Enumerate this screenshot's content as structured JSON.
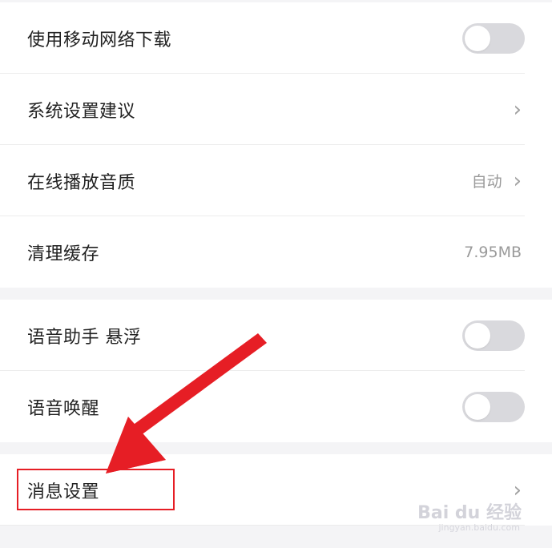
{
  "group1": {
    "items": [
      {
        "label": "使用移动网络下载",
        "toggle": "off"
      },
      {
        "label": "系统设置建议",
        "chevron": "›"
      },
      {
        "label": "在线播放音质",
        "value": "自动",
        "chevron": "›"
      },
      {
        "label": "清理缓存",
        "value": "7.95MB"
      }
    ]
  },
  "group2": {
    "items": [
      {
        "label": "语音助手 悬浮",
        "toggle": "off"
      },
      {
        "label": "语音唤醒",
        "toggle": "off"
      }
    ]
  },
  "group3": {
    "items": [
      {
        "label": "消息设置",
        "chevron": "›"
      }
    ]
  },
  "annotation": {
    "color": "#e61e25"
  },
  "watermark": {
    "text": "Bai du 经验",
    "sub": "jingyan.baidu.com"
  }
}
